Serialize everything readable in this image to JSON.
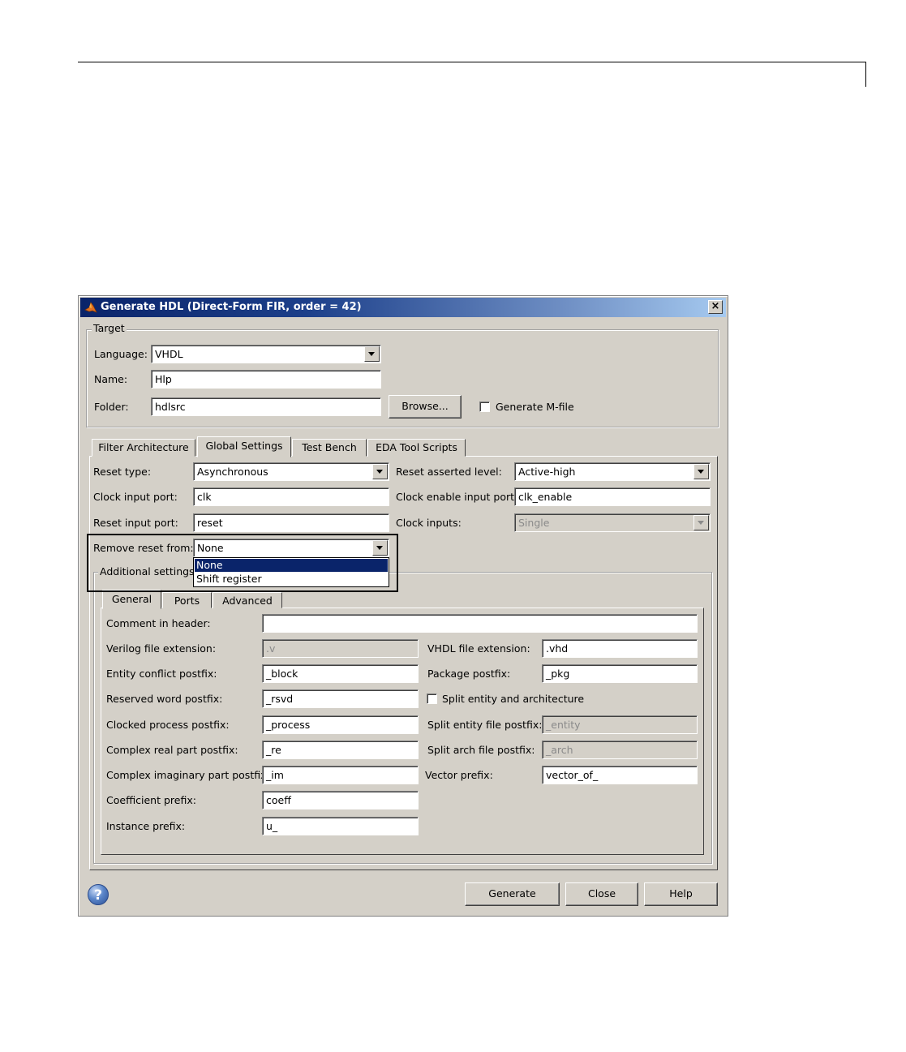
{
  "window": {
    "title": "Generate HDL (Direct-Form FIR, order = 42)",
    "close_glyph": "×"
  },
  "target": {
    "legend": "Target",
    "language_label": "Language:",
    "language_value": "VHDL",
    "name_label": "Name:",
    "name_value": "Hlp",
    "folder_label": "Folder:",
    "folder_value": "hdlsrc",
    "browse_label": "Browse...",
    "generate_mfile_label": "Generate M-file",
    "generate_mfile_checked": false
  },
  "main_tabs": [
    "Filter Architecture",
    "Global Settings",
    "Test Bench",
    "EDA Tool Scripts"
  ],
  "active_main_tab": "Global Settings",
  "global": {
    "reset_type_label": "Reset type:",
    "reset_type_value": "Asynchronous",
    "reset_asserted_label": "Reset asserted level:",
    "reset_asserted_value": "Active-high",
    "clock_input_label": "Clock input port:",
    "clock_input_value": "clk",
    "clock_enable_label": "Clock enable input port:",
    "clock_enable_value": "clk_enable",
    "reset_input_label": "Reset input port:",
    "reset_input_value": "reset",
    "clock_inputs_label": "Clock inputs:",
    "clock_inputs_value": "Single",
    "remove_reset_label": "Remove reset from:",
    "remove_reset_value": "None",
    "remove_reset_options": [
      "None",
      "Shift register"
    ],
    "remove_reset_selected": "None"
  },
  "additional": {
    "legend": "Additional settings",
    "tabs": [
      "General",
      "Ports",
      "Advanced"
    ],
    "active_tab": "General",
    "comment_label": "Comment in header:",
    "comment_value": "",
    "verilog_ext_label": "Verilog file extension:",
    "verilog_ext_value": ".v",
    "vhdl_ext_label": "VHDL file extension:",
    "vhdl_ext_value": ".vhd",
    "entity_conflict_label": "Entity conflict postfix:",
    "entity_conflict_value": "_block",
    "package_postfix_label": "Package postfix:",
    "package_postfix_value": "_pkg",
    "reserved_word_label": "Reserved word postfix:",
    "reserved_word_value": "_rsvd",
    "split_entity_arch_label": "Split entity and architecture",
    "split_entity_arch_checked": false,
    "clocked_process_label": "Clocked process postfix:",
    "clocked_process_value": "_process",
    "split_entity_file_label": "Split entity file postfix:",
    "split_entity_file_value": "_entity",
    "complex_real_label": "Complex real part postfix:",
    "complex_real_value": "_re",
    "split_arch_file_label": "Split arch file postfix:",
    "split_arch_file_value": "_arch",
    "complex_imag_label": "Complex imaginary part postfix:",
    "complex_imag_value": "_im",
    "vector_prefix_label": "Vector prefix:",
    "vector_prefix_value": "vector_of_",
    "coeff_prefix_label": "Coefficient prefix:",
    "coeff_prefix_value": "coeff",
    "instance_prefix_label": "Instance prefix:",
    "instance_prefix_value": "u_"
  },
  "footer": {
    "help_glyph": "?",
    "generate_label": "Generate",
    "close_label": "Close",
    "help_label": "Help"
  }
}
